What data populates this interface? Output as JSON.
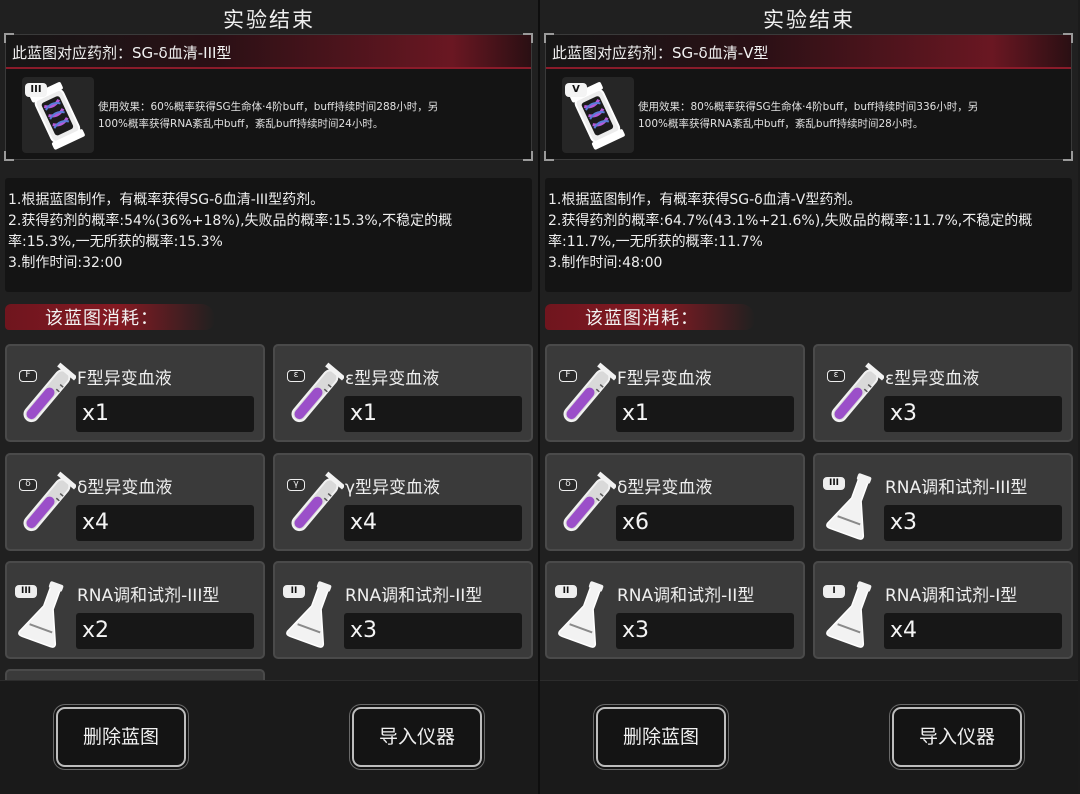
{
  "panels": [
    {
      "title": "实验结束",
      "blueprint": {
        "header": "此蓝图对应药剂：SG-δ血清-III型",
        "serum_badge": "III",
        "serum_icon": "serum-vial-icon",
        "effect_line1": "使用效果：60%概率获得SG生命体·4阶buff，buff持续时间288小时，另",
        "effect_line2": "100%概率获得RNA紊乱中buff，紊乱buff持续时间24小时。"
      },
      "info": {
        "line1": "1.根据蓝图制作，有概率获得SG-δ血清-III型药剂。",
        "line2": "2.获得药剂的概率:54%(36%+18%),失败品的概率:15.3%,不稳定的概",
        "line3": "率:15.3%,一无所获的概率:15.3%",
        "line4": "3.制作时间:32:00"
      },
      "cost_label": "该蓝图消耗：",
      "materials": [
        {
          "name": "F型异变血液",
          "qty": "x1",
          "badge": "F",
          "icon": "blood-tube-icon"
        },
        {
          "name": "ε型异变血液",
          "qty": "x1",
          "badge": "ε",
          "icon": "blood-tube-icon"
        },
        {
          "name": "δ型异变血液",
          "qty": "x4",
          "badge": "δ",
          "icon": "blood-tube-icon"
        },
        {
          "name": "γ型异变血液",
          "qty": "x4",
          "badge": "γ",
          "icon": "blood-tube-icon"
        },
        {
          "name": "RNA调和试剂-III型",
          "qty": "x2",
          "badge": "III",
          "icon": "flask-icon"
        },
        {
          "name": "RNA调和试剂-II型",
          "qty": "x3",
          "badge": "II",
          "icon": "flask-icon"
        }
      ],
      "buttons": {
        "delete": "删除蓝图",
        "import": "导入仪器"
      }
    },
    {
      "title": "实验结束",
      "blueprint": {
        "header": "此蓝图对应药剂：SG-δ血清-V型",
        "serum_badge": "V",
        "serum_icon": "serum-vial-icon",
        "effect_line1": "使用效果：80%概率获得SG生命体·4阶buff，buff持续时间336小时，另",
        "effect_line2": "100%概率获得RNA紊乱中buff，紊乱buff持续时间28小时。"
      },
      "info": {
        "line1": "1.根据蓝图制作，有概率获得SG-δ血清-V型药剂。",
        "line2": "2.获得药剂的概率:64.7%(43.1%+21.6%),失败品的概率:11.7%,不稳定的概",
        "line3": "率:11.7%,一无所获的概率:11.7%",
        "line4": "3.制作时间:48:00"
      },
      "cost_label": "该蓝图消耗：",
      "materials": [
        {
          "name": "F型异变血液",
          "qty": "x1",
          "badge": "F",
          "icon": "blood-tube-icon"
        },
        {
          "name": "ε型异变血液",
          "qty": "x3",
          "badge": "ε",
          "icon": "blood-tube-icon"
        },
        {
          "name": "δ型异变血液",
          "qty": "x6",
          "badge": "δ",
          "icon": "blood-tube-icon"
        },
        {
          "name": "RNA调和试剂-III型",
          "qty": "x3",
          "badge": "III",
          "icon": "flask-icon"
        },
        {
          "name": "RNA调和试剂-II型",
          "qty": "x3",
          "badge": "II",
          "icon": "flask-icon"
        },
        {
          "name": "RNA调和试剂-I型",
          "qty": "x4",
          "badge": "I",
          "icon": "flask-icon"
        }
      ],
      "buttons": {
        "delete": "删除蓝图",
        "import": "导入仪器"
      }
    }
  ],
  "colors": {
    "accent_red": "#8a1b2a",
    "liquid_purple": "#9b4fc9",
    "panel_bg": "#202020"
  }
}
